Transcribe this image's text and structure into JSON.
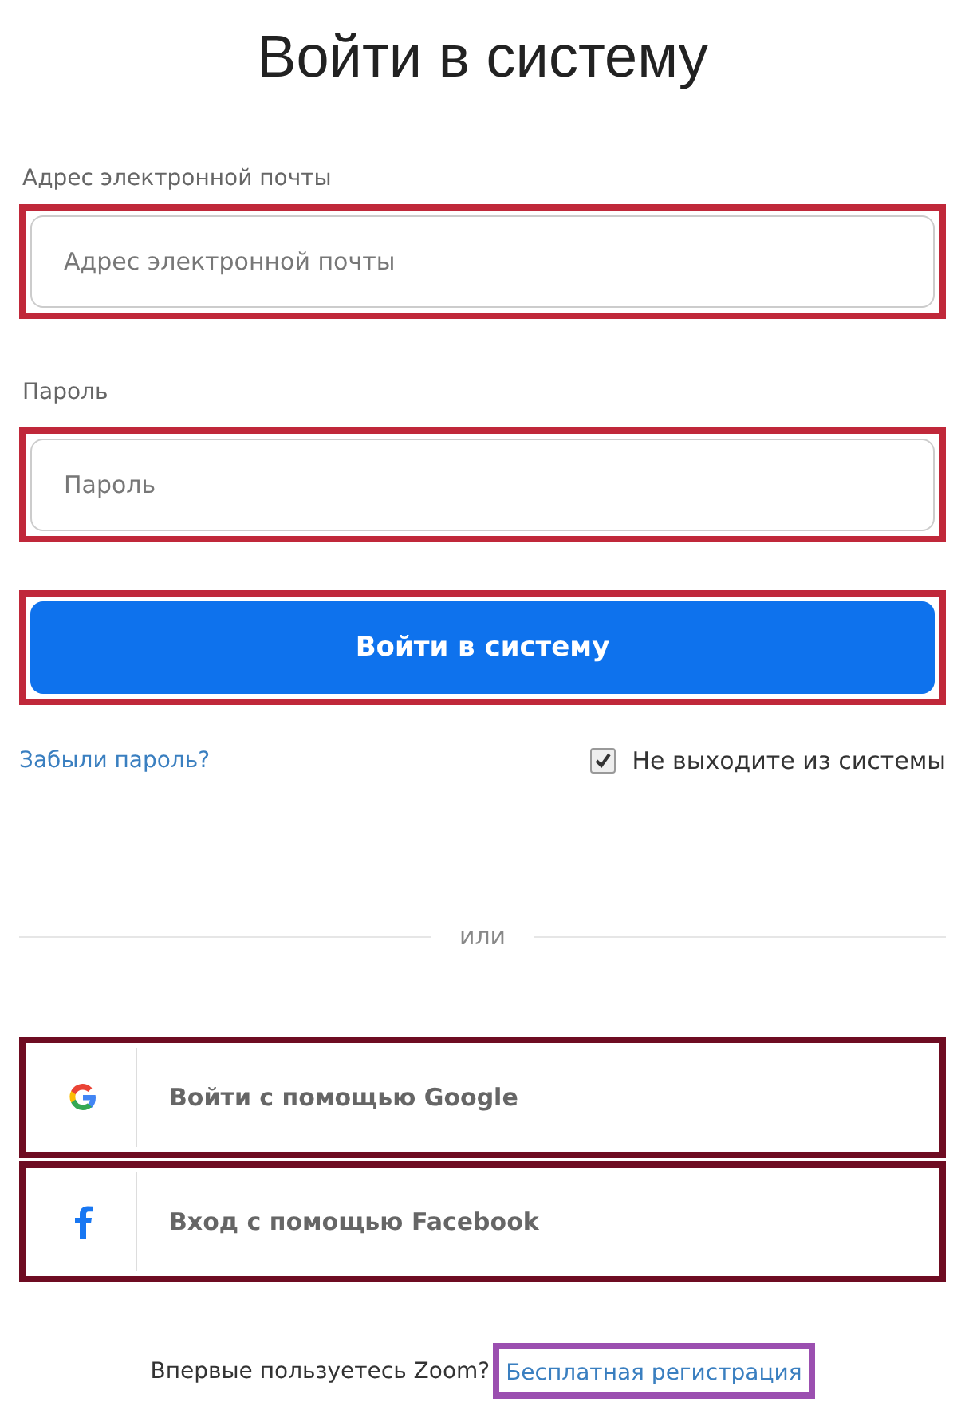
{
  "title": "Войти в систему",
  "fields": [
    {
      "label": "Адрес электронной почты",
      "placeholder": "Адрес электронной почты",
      "highlighted": true
    },
    {
      "label": "Пароль",
      "placeholder": "Пароль",
      "highlighted": true
    }
  ],
  "submit": {
    "label": "Войти в систему",
    "highlighted": true
  },
  "forgot_link": "Забыли пароль?",
  "stay_signed_in": {
    "label": "Не выходите из системы",
    "checked": true
  },
  "divider": "или",
  "social": [
    {
      "kind": "google",
      "label": "Войти с помощью Google",
      "highlighted": true
    },
    {
      "kind": "facebook",
      "label": "Вход с помощью Facebook",
      "highlighted": true
    }
  ],
  "footer": {
    "text": "Впервые пользуетесь Zoom?",
    "link": "Бесплатная регистрация",
    "highlighted": true
  }
}
